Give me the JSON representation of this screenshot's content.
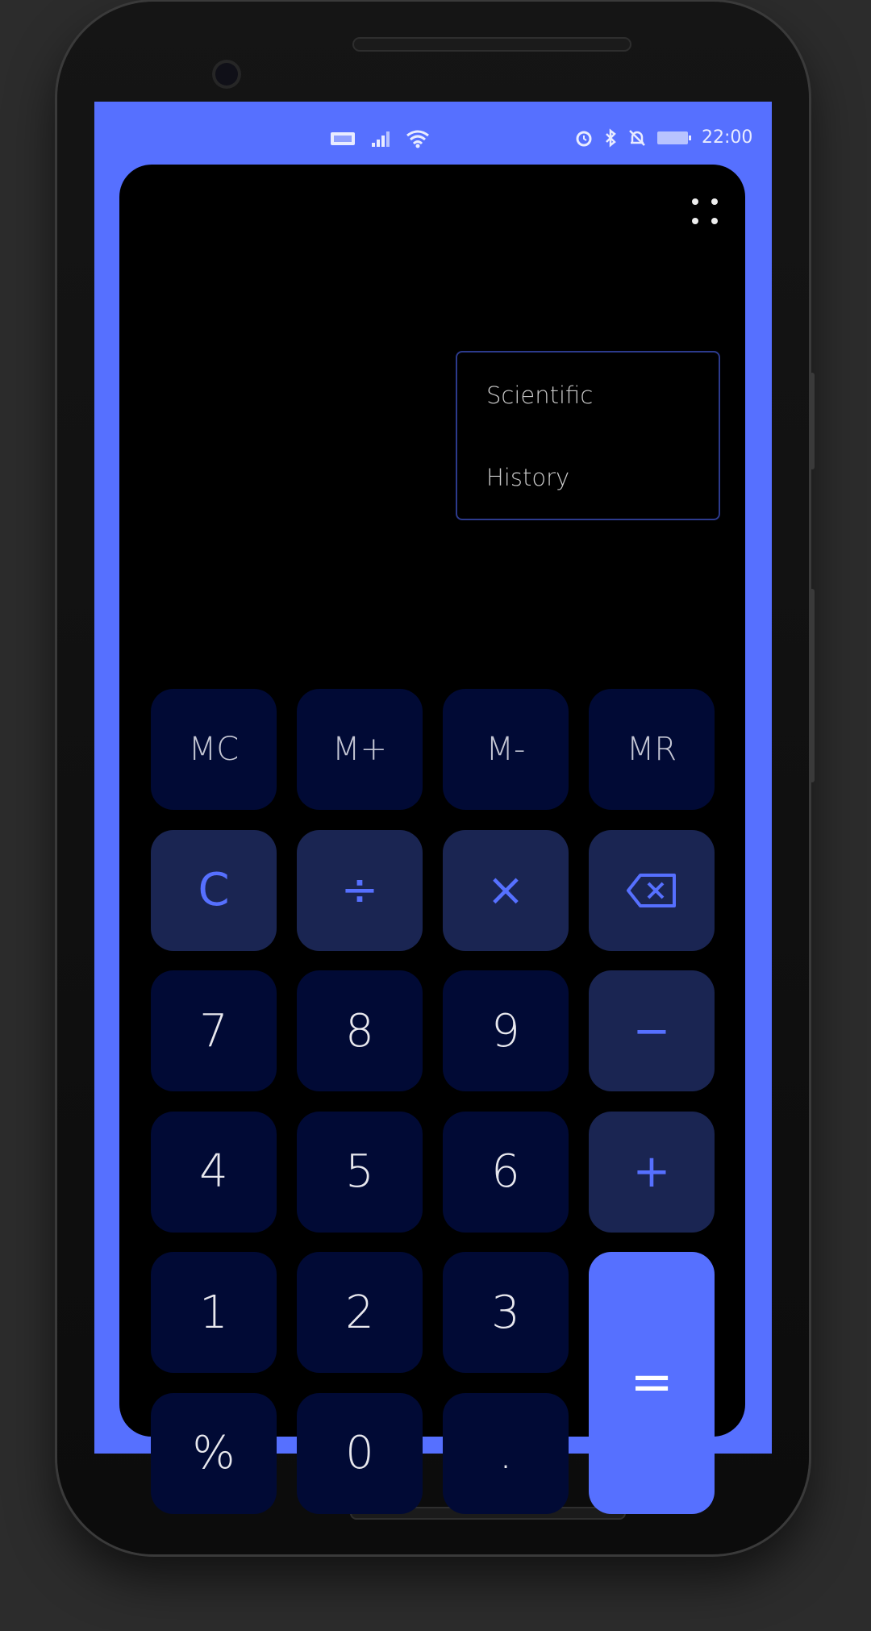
{
  "status_bar": {
    "left_icons": [
      "volte-icon",
      "signal-icon",
      "wifi-icon"
    ],
    "right_icons": [
      "alarm-icon",
      "bluetooth-icon",
      "mute-icon",
      "battery-icon"
    ],
    "time": "22:00"
  },
  "menu": {
    "icon": "more-dots-icon",
    "items": [
      {
        "label": "Scientific"
      },
      {
        "label": "History"
      }
    ]
  },
  "keypad": {
    "rows": [
      [
        {
          "label": "MC",
          "kind": "mem"
        },
        {
          "label": "M+",
          "kind": "mem"
        },
        {
          "label": "M-",
          "kind": "mem"
        },
        {
          "label": "MR",
          "kind": "mem"
        }
      ],
      [
        {
          "label": "C",
          "kind": "op"
        },
        {
          "label": "÷",
          "kind": "op"
        },
        {
          "label": "×",
          "kind": "op"
        },
        {
          "label": "",
          "kind": "op",
          "icon": "backspace-icon"
        }
      ],
      [
        {
          "label": "7",
          "kind": "num"
        },
        {
          "label": "8",
          "kind": "num"
        },
        {
          "label": "9",
          "kind": "num"
        },
        {
          "label": "−",
          "kind": "op"
        }
      ],
      [
        {
          "label": "4",
          "kind": "num"
        },
        {
          "label": "5",
          "kind": "num"
        },
        {
          "label": "6",
          "kind": "num"
        },
        {
          "label": "+",
          "kind": "op"
        }
      ],
      [
        {
          "label": "1",
          "kind": "num"
        },
        {
          "label": "2",
          "kind": "num"
        },
        {
          "label": "3",
          "kind": "num"
        },
        {
          "label": "=",
          "kind": "eq",
          "span": 2
        }
      ],
      [
        {
          "label": "%",
          "kind": "num"
        },
        {
          "label": "0",
          "kind": "num"
        },
        {
          "label": ".",
          "kind": "num"
        }
      ]
    ]
  },
  "colors": {
    "accent": "#5670ff",
    "key_dark": "#010a35",
    "key_op": "#1a2552",
    "background": "#000000"
  }
}
